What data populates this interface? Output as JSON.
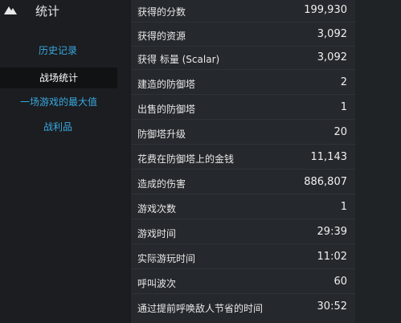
{
  "header": {
    "title": "统计",
    "icon": "mountain-logo-icon"
  },
  "nav": {
    "history": "历史记录",
    "battle_stats": "战场统计",
    "max_single_game": "一场游戏的最大值",
    "loot": "战利品"
  },
  "stats": [
    {
      "label": "获得的分数",
      "value": "199,930"
    },
    {
      "label": "获得的资源",
      "value": "3,092"
    },
    {
      "label": "获得 标量 (Scalar)",
      "value": "3,092"
    },
    {
      "label": "建造的防御塔",
      "value": "2"
    },
    {
      "label": "出售的防御塔",
      "value": "1"
    },
    {
      "label": "防御塔升级",
      "value": "20"
    },
    {
      "label": "花费在防御塔上的金钱",
      "value": "11,143"
    },
    {
      "label": "造成的伤害",
      "value": "886,807"
    },
    {
      "label": "游戏次数",
      "value": "1"
    },
    {
      "label": "游戏时间",
      "value": "29:39"
    },
    {
      "label": "实际游玩时间",
      "value": "11:02"
    },
    {
      "label": "呼叫波次",
      "value": "60"
    },
    {
      "label": "通过提前呼唤敌人节省的时间",
      "value": "30:52"
    }
  ]
}
